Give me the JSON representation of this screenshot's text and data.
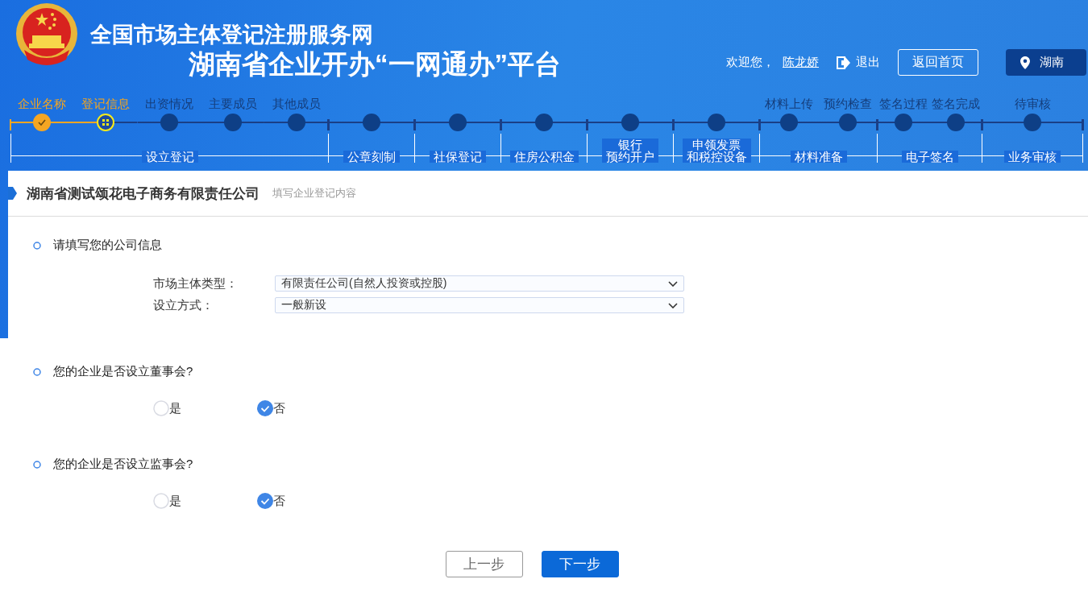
{
  "header": {
    "site_title": "全国市场主体登记注册服务网",
    "platform_title": "湖南省企业开办“一网通办”平台",
    "welcome": "欢迎您，",
    "user": "陈龙娇",
    "logout": "退出",
    "home_button": "返回首页",
    "region": "湖南"
  },
  "progress": {
    "groups": [
      {
        "label": "设立登记",
        "steps": [
          {
            "label": "企业名称",
            "kind": "done"
          },
          {
            "label": "登记信息",
            "kind": "current"
          },
          {
            "label": "出资情况",
            "kind": "todo"
          },
          {
            "label": "主要成员",
            "kind": "todo"
          },
          {
            "label": "其他成员",
            "kind": "todo"
          }
        ]
      },
      {
        "label": "公章刻制",
        "steps": [
          {
            "kind": "todo"
          }
        ]
      },
      {
        "label": "社保登记",
        "steps": [
          {
            "kind": "todo"
          }
        ]
      },
      {
        "label": "住房公积金",
        "steps": [
          {
            "kind": "todo"
          }
        ]
      },
      {
        "label_lines": [
          "银行",
          "预约开户"
        ],
        "steps": [
          {
            "kind": "todo"
          }
        ]
      },
      {
        "label_lines": [
          "申领发票",
          "和税控设备"
        ],
        "steps": [
          {
            "kind": "todo"
          }
        ]
      },
      {
        "label": "材料准备",
        "steps": [
          {
            "label": "材料上传",
            "kind": "todo"
          },
          {
            "label": "预约检查",
            "kind": "todo"
          }
        ]
      },
      {
        "label": "电子签名",
        "steps": [
          {
            "label": "签名过程",
            "kind": "todo"
          },
          {
            "label": "签名完成",
            "kind": "todo"
          }
        ]
      },
      {
        "label": "业务审核",
        "steps": [
          {
            "label": "待审核",
            "kind": "todo"
          }
        ]
      }
    ]
  },
  "page_header": {
    "title": "湖南省测试颂花电子商务有限责任公司",
    "subtitle": "填写企业登记内容"
  },
  "sections": [
    {
      "kind": "fields",
      "title": "请填写您的公司信息",
      "fields": [
        {
          "label": "市场主体类型：",
          "value": "有限责任公司(自然人投资或控股)"
        },
        {
          "label": "设立方式：",
          "value": "一般新设"
        }
      ]
    },
    {
      "kind": "radios",
      "title": "您的企业是否设立董事会?",
      "options": [
        {
          "label": "是",
          "selected": false
        },
        {
          "label": "否",
          "selected": true
        }
      ]
    },
    {
      "kind": "radios",
      "title": "您的企业是否设立监事会?",
      "options": [
        {
          "label": "是",
          "selected": false
        },
        {
          "label": "否",
          "selected": true
        }
      ]
    }
  ],
  "buttons": [
    {
      "label": "上一步",
      "kind": "secondary"
    },
    {
      "label": "下一步",
      "kind": "primary"
    }
  ]
}
